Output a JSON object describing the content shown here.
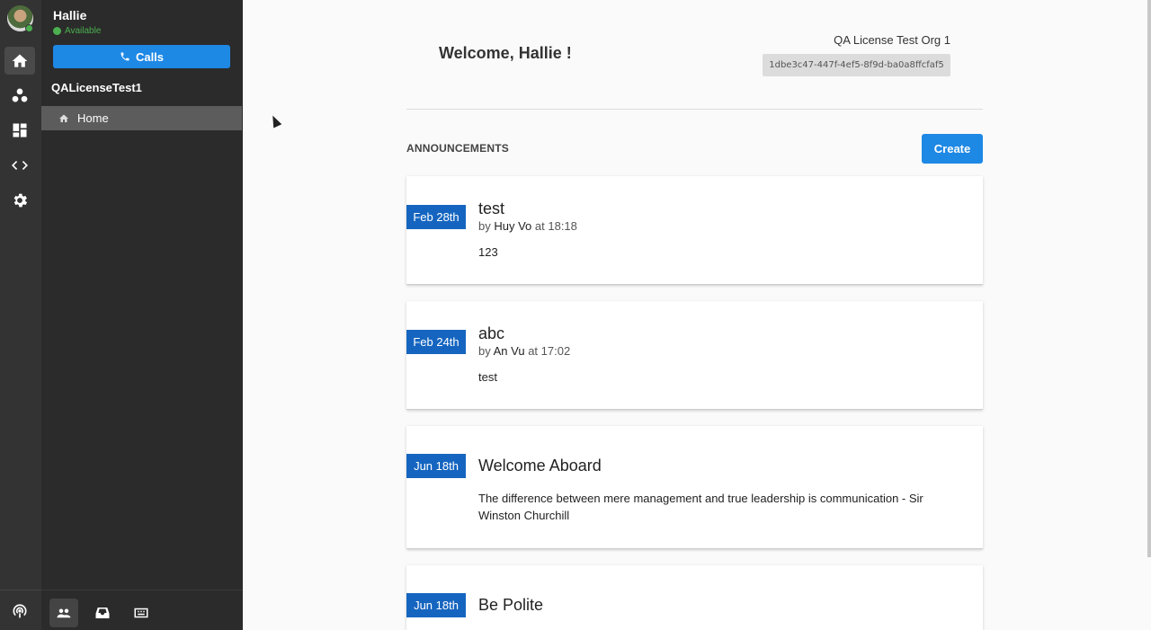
{
  "user": {
    "name": "Hallie",
    "status": "Available"
  },
  "sidebar": {
    "calls_label": "Calls",
    "org_name": "QALicenseTest1",
    "nav": [
      {
        "label": "Home",
        "icon": "home-icon"
      }
    ]
  },
  "rail_icons": [
    "home-icon",
    "contacts-icon",
    "dashboard-icon",
    "code-icon",
    "settings-icon",
    "broadcast-icon"
  ],
  "sidebar_bottom_icons": [
    "team-icon",
    "inbox-icon",
    "board-icon"
  ],
  "header": {
    "welcome": "Welcome, Hallie !",
    "org_title": "QA License Test Org 1",
    "org_id": "1dbe3c47-447f-4ef5-8f9d-ba0a8ffcfaf5"
  },
  "announcements": {
    "title": "ANNOUNCEMENTS",
    "create_label": "Create",
    "items": [
      {
        "date": "Feb 28th",
        "title": "test",
        "by": "by",
        "author": "Huy Vo",
        "at": "at 18:18",
        "body": "123"
      },
      {
        "date": "Feb 24th",
        "title": "abc",
        "by": "by",
        "author": "An Vu",
        "at": "at 17:02",
        "body": "test"
      },
      {
        "date": "Jun 18th",
        "title": "Welcome Aboard",
        "body": "The difference between mere management and true leadership is communication - Sir Winston Churchill"
      },
      {
        "date": "Jun 18th",
        "title": "Be Polite"
      }
    ]
  },
  "colors": {
    "accent": "#1e88e5",
    "badge": "#1565c0",
    "rail": "#333333",
    "sidebar": "#2b2b2b",
    "available": "#4caf50"
  }
}
